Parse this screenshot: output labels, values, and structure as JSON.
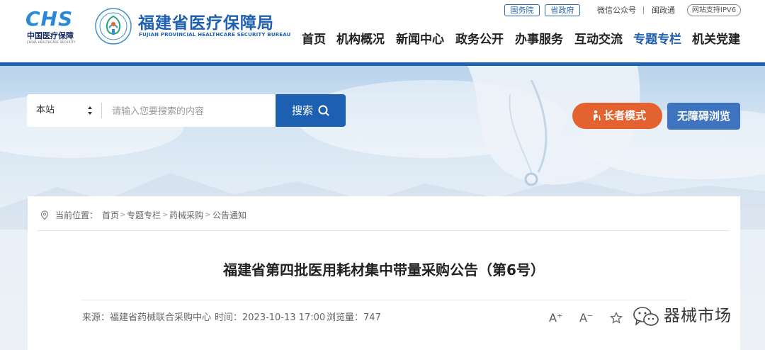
{
  "header": {
    "chs_logo": {
      "mark": "CHS",
      "cn": "中国医疗保障",
      "en": "CHINA HEALTHCARE SECURITY"
    },
    "seal_icon": "bureau-seal-icon",
    "bureau_name_cn": "福建省医疗保障局",
    "bureau_name_en": "FUJIAN PROVINCIAL HEALTHCARE SECURITY BUREAU",
    "top_links": {
      "state_council": "国务院",
      "provincial_gov": "省政府",
      "wechat": "微信公众号",
      "minzheng": "闽政通",
      "ipv6": "网站支持IPV6"
    },
    "nav": [
      "首页",
      "机构概况",
      "新闻中心",
      "政务公开",
      "办事服务",
      "互动交流",
      "专题专栏",
      "机关党建"
    ],
    "active_nav": "专题专栏",
    "colors": {
      "brand": "#1d5fb0",
      "elder": "#e4622f",
      "access": "#3e74bf"
    }
  },
  "search": {
    "scope": "本站",
    "placeholder": "请输入您要搜索的内容",
    "button_label": "搜索",
    "button_icon": "search-icon"
  },
  "modes": {
    "elder_label": "长者模式",
    "elder_icon": "elder-person-icon",
    "accessible_label": "无障碍浏览"
  },
  "breadcrumb": {
    "prefix": "当前位置：",
    "icon": "location-pin-icon",
    "items": [
      "首页",
      "专题专栏",
      "药械采购",
      "公告通知"
    ]
  },
  "article": {
    "title": "福建省第四批医用耗材集中带量采购公告（第6号）",
    "source": "来源：福建省药械联合采购中心",
    "time": "时间：2023-10-13 17:00",
    "views": "浏览量：747",
    "tools": {
      "font_up": "A⁺",
      "font_down": "A⁻",
      "favorite_icon": "star-icon"
    }
  },
  "watermark": {
    "text": "器械市场",
    "icon": "wechat-icon"
  }
}
